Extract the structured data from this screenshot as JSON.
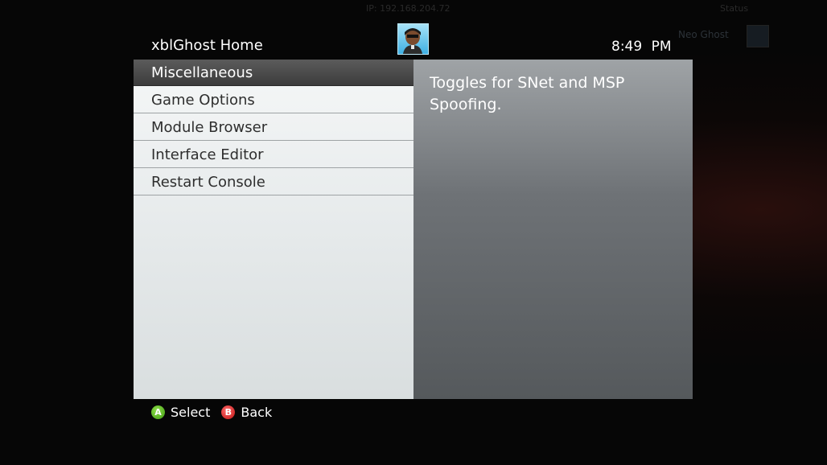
{
  "dim_overlay": {
    "top_left": "                      ",
    "top_center": "IP: 192.168.204.72",
    "top_right": "Status",
    "gamertag": "Neo Ghost"
  },
  "header": {
    "title": "xblGhost Home",
    "time": "8:49 PM"
  },
  "menu": {
    "items": [
      {
        "label": "Miscellaneous",
        "selected": true
      },
      {
        "label": "Game Options",
        "selected": false
      },
      {
        "label": "Module Browser",
        "selected": false
      },
      {
        "label": "Interface Editor",
        "selected": false
      },
      {
        "label": "Restart Console",
        "selected": false
      }
    ]
  },
  "description": {
    "text": "Toggles for SNet and MSP Spoofing."
  },
  "footer": {
    "select_button": "A",
    "select_label": "Select",
    "back_button": "B",
    "back_label": "Back"
  },
  "colors": {
    "a_button": "#4caf1a",
    "b_button": "#d61c1c",
    "selected_item": "#464646"
  }
}
